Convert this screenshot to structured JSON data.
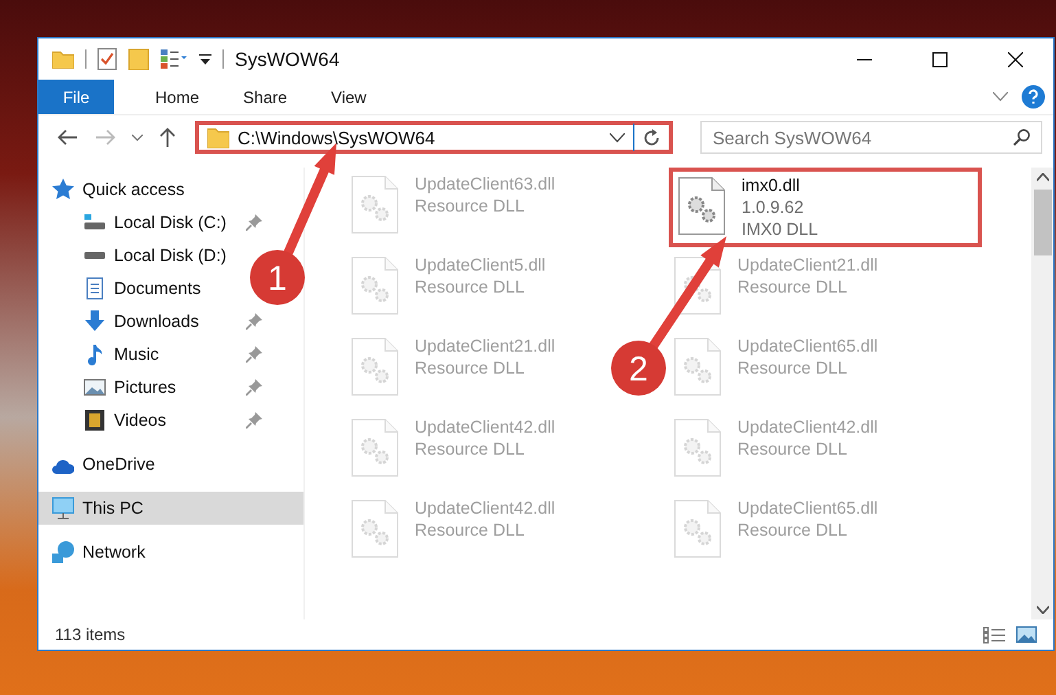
{
  "window": {
    "title": "SysWOW64"
  },
  "ribbon_tabs": [
    {
      "label": "File",
      "selected": true
    },
    {
      "label": "Home",
      "selected": false
    },
    {
      "label": "Share",
      "selected": false
    },
    {
      "label": "View",
      "selected": false
    }
  ],
  "address_bar": {
    "path": "C:\\Windows\\SysWOW64",
    "highlighted": true
  },
  "search": {
    "placeholder": "Search SysWOW64"
  },
  "sidebar": {
    "items": [
      {
        "label": "Quick access",
        "selected": false,
        "children": [
          {
            "label": "Local Disk (C:)",
            "pinned": true
          },
          {
            "label": "Local Disk (D:)",
            "pinned": false
          },
          {
            "label": "Documents",
            "pinned": false
          },
          {
            "label": "Downloads",
            "pinned": true
          },
          {
            "label": "Music",
            "pinned": true
          },
          {
            "label": "Pictures",
            "pinned": true
          },
          {
            "label": "Videos",
            "pinned": true
          }
        ]
      },
      {
        "label": "OneDrive",
        "selected": false
      },
      {
        "label": "This PC",
        "selected": true
      },
      {
        "label": "Network",
        "selected": false
      }
    ]
  },
  "files": [
    {
      "name": "UpdateClient63.dll",
      "lines": [
        "Resource DLL"
      ],
      "highlighted": false
    },
    {
      "name": "imx0.dll",
      "lines": [
        "1.0.9.62",
        "IMX0 DLL"
      ],
      "highlighted": true
    },
    {
      "name": "UpdateClient5.dll",
      "lines": [
        "Resource DLL"
      ],
      "highlighted": false
    },
    {
      "name": "UpdateClient21.dll",
      "lines": [
        "Resource DLL"
      ],
      "highlighted": false
    },
    {
      "name": "UpdateClient21.dll",
      "lines": [
        "Resource DLL"
      ],
      "highlighted": false
    },
    {
      "name": "UpdateClient65.dll",
      "lines": [
        "Resource DLL"
      ],
      "highlighted": false
    },
    {
      "name": "UpdateClient42.dll",
      "lines": [
        "Resource DLL"
      ],
      "highlighted": false
    },
    {
      "name": "UpdateClient42.dll",
      "lines": [
        "Resource DLL"
      ],
      "highlighted": false
    },
    {
      "name": "UpdateClient42.dll",
      "lines": [
        "Resource DLL"
      ],
      "highlighted": false
    },
    {
      "name": "UpdateClient65.dll",
      "lines": [
        "Resource DLL"
      ],
      "highlighted": false
    }
  ],
  "status_bar": {
    "item_count": "113 items"
  },
  "annotations": [
    {
      "label": "1"
    },
    {
      "label": "2"
    }
  ]
}
